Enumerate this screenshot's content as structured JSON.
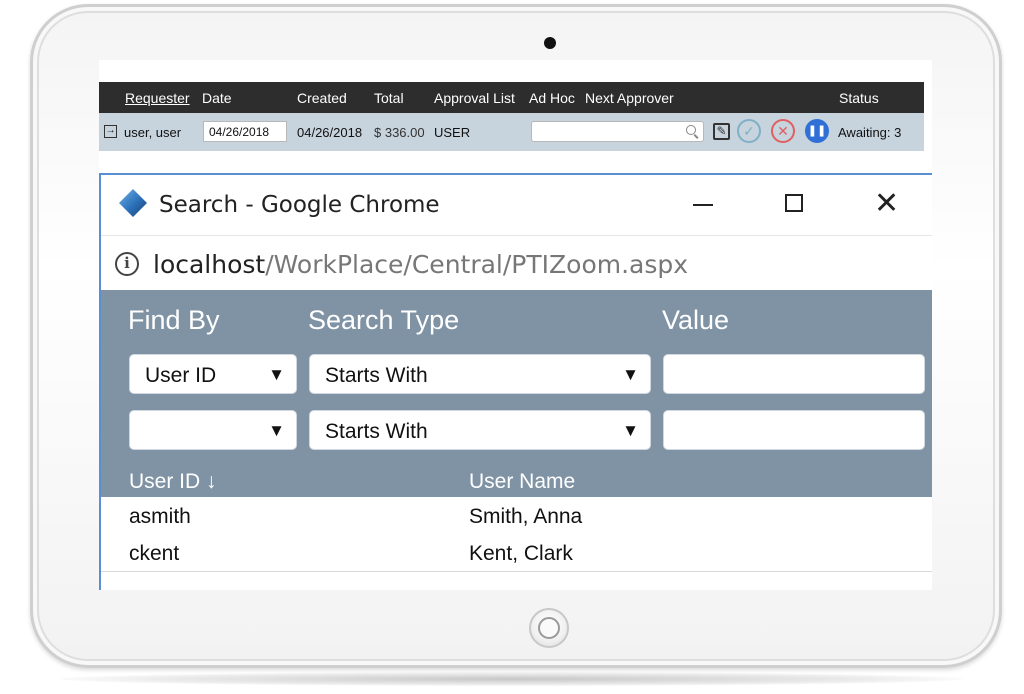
{
  "grid": {
    "headers": {
      "requester": "Requester",
      "date": "Date",
      "created": "Created",
      "total": "Total",
      "approval_list": "Approval List",
      "ad_hoc": "Ad Hoc",
      "next_approver": "Next Approver",
      "status": "Status"
    },
    "row": {
      "nav_icon": "arrow-right-box-icon",
      "requester": "user, user",
      "date": "04/26/2018",
      "created": "04/26/2018",
      "total": "$ 336.00",
      "approval_list": "USER",
      "ad_hoc_value": "",
      "status": "Awaiting: 3"
    }
  },
  "popup": {
    "window_title": "Search - Google Chrome",
    "url_host": "localhost",
    "url_path": "/WorkPlace/Central/PTIZoom.aspx",
    "labels": {
      "find_by": "Find By",
      "search_type": "Search Type",
      "value": "Value"
    },
    "filters": [
      {
        "find_by": "User ID",
        "search_type": "Starts With",
        "value": ""
      },
      {
        "find_by": "",
        "search_type": "Starts With",
        "value": ""
      }
    ],
    "dropdown_glyph": "▼",
    "columns": {
      "user_id": "User ID ↓",
      "user_name": "User Name"
    },
    "results": [
      {
        "user_id": "asmith",
        "user_name": "Smith, Anna"
      },
      {
        "user_id": "ckent",
        "user_name": "Kent, Clark"
      }
    ]
  },
  "colors": {
    "grid_header_bg": "#2d2d2d",
    "grid_row_bg": "#c7d3dd",
    "panel_bg": "#7f93a5",
    "accent_blue": "#2f6fd6",
    "reject_red": "#e06060"
  }
}
